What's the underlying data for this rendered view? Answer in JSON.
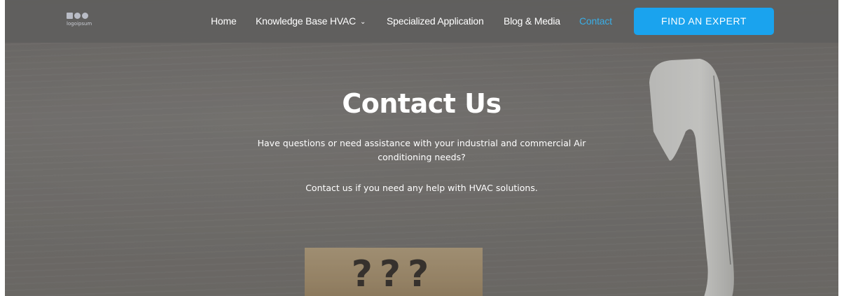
{
  "logo": {
    "text": "logoipsum"
  },
  "nav": {
    "items": [
      {
        "label": "Home"
      },
      {
        "label": "Knowledge Base HVAC"
      },
      {
        "label": "Specialized Application"
      },
      {
        "label": "Blog & Media"
      },
      {
        "label": "Contact"
      }
    ],
    "active_item": "Contact",
    "cta_label": "FIND AN EXPERT"
  },
  "hero": {
    "title": "Contact Us",
    "subtitle": "Have questions or need assistance with your industrial and commercial Air conditioning needs?",
    "line2": "Contact us if you need any help with HVAC solutions.",
    "block_marks": "???"
  },
  "colors": {
    "accent": "#1aa3ee",
    "active_link": "#3aaee6",
    "navbar_bg": "#605e5d"
  },
  "icons": {
    "dropdown": "chevron-down-icon"
  }
}
